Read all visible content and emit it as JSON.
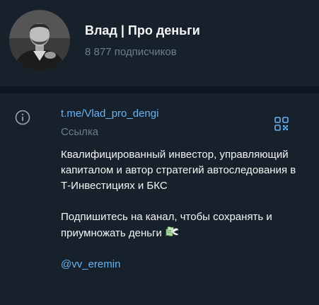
{
  "channel": {
    "title": "Влад | Про деньги",
    "subscribers": "8 877 подписчиков"
  },
  "info": {
    "link": "t.me/Vlad_pro_dengi",
    "link_caption": "Ссылка",
    "description_p1": "Квалифицированный инвестор, управляющий капиталом и автор стратегий автоследования в Т-Инвестициях и БКС",
    "description_p2": "Подпишитесь на канал, чтобы сохранять и приумножать деньги",
    "mention": "@vv_eremin"
  },
  "icons": {
    "info": "info-circle-icon",
    "qr": "qr-code-icon",
    "emoji": "money-with-wings-emoji"
  },
  "colors": {
    "background": "#17212b",
    "divider": "#0e1621",
    "link": "#6ab3f3",
    "muted": "#6d7f8f",
    "text": "#f5f5f5"
  }
}
